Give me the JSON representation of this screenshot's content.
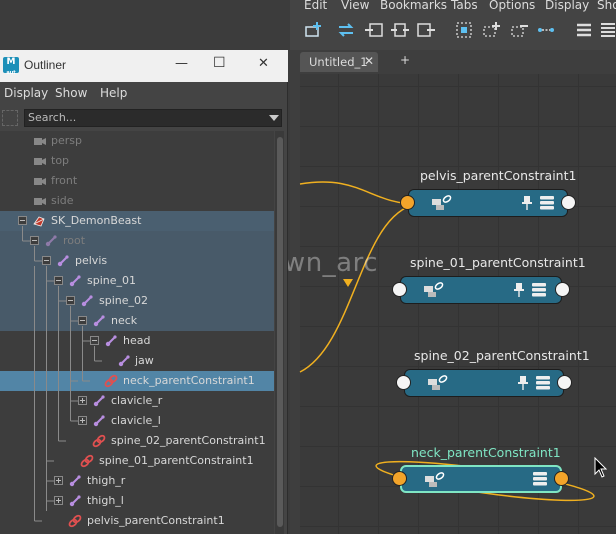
{
  "node_editor": {
    "menu": [
      "Edit",
      "View",
      "Bookmarks",
      "Tabs",
      "Options",
      "Display",
      "Sho"
    ],
    "toolbar_icons": [
      "add-node-icon",
      "swap-icon",
      "input-connections-icon",
      "input-output-icon",
      "output-connections-icon",
      "frame-selection-icon",
      "add-selected-icon",
      "remove-selected-icon",
      "graph-icon",
      "layout-simple-icon",
      "layout-full-icon"
    ],
    "tab": {
      "label": "Untitled_1",
      "close": "✕",
      "add": "+"
    },
    "watermark": "@dawn_arc",
    "nodes": [
      {
        "title": "pelvis_parentConstraint1",
        "selected": false
      },
      {
        "title": "spine_01_parentConstraint1",
        "selected": false
      },
      {
        "title": "spine_02_parentConstraint1",
        "selected": false
      },
      {
        "title": "neck_parentConstraint1",
        "selected": true
      }
    ],
    "colors": {
      "node": "#276a85",
      "selected_border": "#7fe6c4",
      "connection": "#f0b020",
      "port_orange": "#f3a42a"
    }
  },
  "outliner": {
    "title": "Outliner",
    "window_buttons": {
      "minimize": "—",
      "maximize": "☐",
      "close": "✕"
    },
    "menu": [
      "Display",
      "Show",
      "Help"
    ],
    "search": {
      "placeholder": "Search..."
    },
    "rows": [
      {
        "label": "persp",
        "icon": "camera-icon",
        "dim": true
      },
      {
        "label": "top",
        "icon": "camera-icon",
        "dim": true
      },
      {
        "label": "front",
        "icon": "camera-icon",
        "dim": true
      },
      {
        "label": "side",
        "icon": "camera-icon",
        "dim": true
      },
      {
        "label": "SK_DemonBeast",
        "icon": "mesh-icon",
        "dim": false
      },
      {
        "label": "root",
        "icon": "joint-icon",
        "dim": true
      },
      {
        "label": "pelvis",
        "icon": "joint-icon",
        "dim": false
      },
      {
        "label": "spine_01",
        "icon": "joint-icon",
        "dim": false
      },
      {
        "label": "spine_02",
        "icon": "joint-icon",
        "dim": false
      },
      {
        "label": "neck",
        "icon": "joint-icon",
        "dim": false
      },
      {
        "label": "head",
        "icon": "joint-icon",
        "dim": false
      },
      {
        "label": "jaw",
        "icon": "joint-icon",
        "dim": false
      },
      {
        "label": "neck_parentConstraint1",
        "icon": "constraint-icon",
        "dim": false
      },
      {
        "label": "clavicle_r",
        "icon": "joint-icon",
        "dim": false
      },
      {
        "label": "clavicle_l",
        "icon": "joint-icon",
        "dim": false
      },
      {
        "label": "spine_02_parentConstraint1",
        "icon": "constraint-icon",
        "dim": false
      },
      {
        "label": "spine_01_parentConstraint1",
        "icon": "constraint-icon",
        "dim": false
      },
      {
        "label": "thigh_r",
        "icon": "joint-icon",
        "dim": false
      },
      {
        "label": "thigh_l",
        "icon": "joint-icon",
        "dim": false
      },
      {
        "label": "pelvis_parentConstraint1",
        "icon": "constraint-icon",
        "dim": false
      }
    ]
  }
}
